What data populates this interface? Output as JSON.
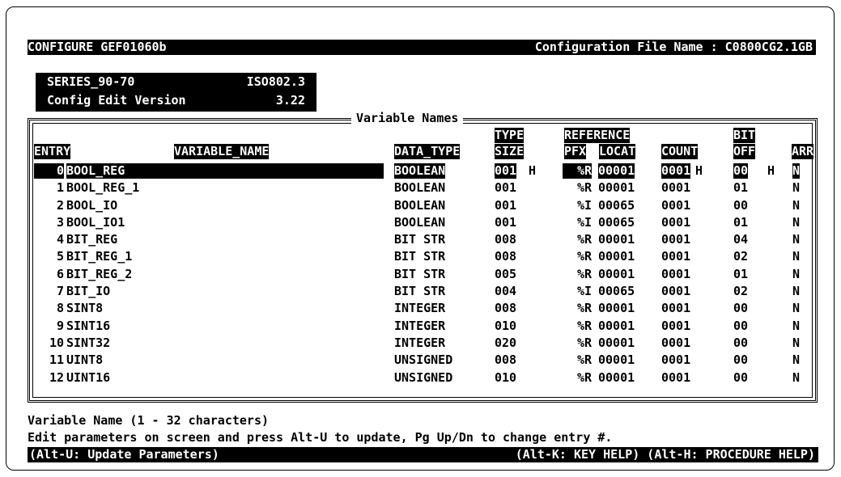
{
  "header": {
    "left": "CONFIGURE GEF01060b",
    "right": "Configuration File Name : C0800CG2.1GB"
  },
  "series": {
    "name": "SERIES_90-70",
    "protocol": "ISO802.3",
    "edit_label": "Config Edit Version",
    "edit_version": "3.22"
  },
  "panel": {
    "title": "Variable Names",
    "columns": {
      "entry": "ENTRY",
      "variable_name": "VARIABLE_NAME",
      "data_type": "DATA_TYPE",
      "type_top": "TYPE",
      "type_size": "SIZE",
      "reference": "REFERENCE",
      "pfx": "PFX",
      "locat": "LOCAT",
      "count": "COUNT",
      "bit_top": "BIT",
      "bit_off": "OFF",
      "arr": "ARR"
    }
  },
  "rows": [
    {
      "entry": "0",
      "name": "BOOL_REG",
      "dtype": "BOOLEAN",
      "size": "001",
      "size_unit": "H",
      "pfx": "%R",
      "loc": "00001",
      "count": "0001",
      "count_unit": "H",
      "bit": "00",
      "bit_unit": "H",
      "arr": "N"
    },
    {
      "entry": "1",
      "name": "BOOL_REG_1",
      "dtype": "BOOLEAN",
      "size": "001",
      "pfx": "%R",
      "loc": "00001",
      "count": "0001",
      "bit": "01",
      "arr": "N"
    },
    {
      "entry": "2",
      "name": "BOOL_IO",
      "dtype": "BOOLEAN",
      "size": "001",
      "pfx": "%I",
      "loc": "00065",
      "count": "0001",
      "bit": "00",
      "arr": "N"
    },
    {
      "entry": "3",
      "name": "BOOL_IO1",
      "dtype": "BOOLEAN",
      "size": "001",
      "pfx": "%I",
      "loc": "00065",
      "count": "0001",
      "bit": "01",
      "arr": "N"
    },
    {
      "entry": "4",
      "name": "BIT_REG",
      "dtype": "BIT STR",
      "size": "008",
      "pfx": "%R",
      "loc": "00001",
      "count": "0001",
      "bit": "04",
      "arr": "N"
    },
    {
      "entry": "5",
      "name": "BIT_REG_1",
      "dtype": "BIT STR",
      "size": "008",
      "pfx": "%R",
      "loc": "00001",
      "count": "0001",
      "bit": "02",
      "arr": "N"
    },
    {
      "entry": "6",
      "name": "BIT_REG_2",
      "dtype": "BIT STR",
      "size": "005",
      "pfx": "%R",
      "loc": "00001",
      "count": "0001",
      "bit": "01",
      "arr": "N"
    },
    {
      "entry": "7",
      "name": "BIT_IO",
      "dtype": "BIT STR",
      "size": "004",
      "pfx": "%I",
      "loc": "00065",
      "count": "0001",
      "bit": "02",
      "arr": "N"
    },
    {
      "entry": "8",
      "name": "SINT8",
      "dtype": "INTEGER",
      "size": "008",
      "pfx": "%R",
      "loc": "00001",
      "count": "0001",
      "bit": "00",
      "arr": "N"
    },
    {
      "entry": "9",
      "name": "SINT16",
      "dtype": "INTEGER",
      "size": "010",
      "pfx": "%R",
      "loc": "00001",
      "count": "0001",
      "bit": "00",
      "arr": "N"
    },
    {
      "entry": "10",
      "name": "SINT32",
      "dtype": "INTEGER",
      "size": "020",
      "pfx": "%R",
      "loc": "00001",
      "count": "0001",
      "bit": "00",
      "arr": "N"
    },
    {
      "entry": "11",
      "name": "UINT8",
      "dtype": "UNSIGNED",
      "size": "008",
      "pfx": "%R",
      "loc": "00001",
      "count": "0001",
      "bit": "00",
      "arr": "N"
    },
    {
      "entry": "12",
      "name": "UINT16",
      "dtype": "UNSIGNED",
      "size": "010",
      "pfx": "%R",
      "loc": "00001",
      "count": "0001",
      "bit": "00",
      "arr": "N"
    }
  ],
  "messages": {
    "line1": "Variable Name (1 - 32 characters)",
    "line2": "Edit parameters on screen and press Alt-U to update, Pg Up/Dn to change entry #."
  },
  "statusbar": {
    "left": "(Alt-U: Update Parameters)",
    "right": "(Alt-K: KEY HELP) (Alt-H: PROCEDURE HELP)"
  },
  "colors": {
    "foreground": "#000000",
    "background": "#ffffff"
  }
}
